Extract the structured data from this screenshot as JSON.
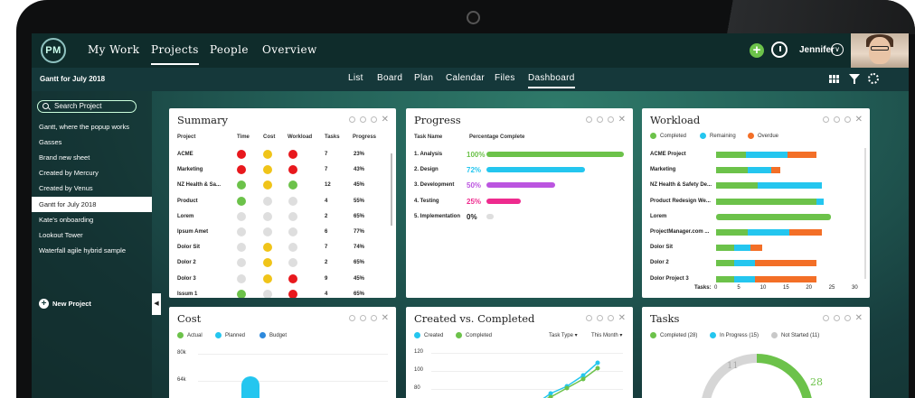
{
  "app": {
    "logo": "PM"
  },
  "topnav": {
    "items": [
      "My Work",
      "Projects",
      "People",
      "Overview"
    ],
    "active": "Projects",
    "user": "Jennifer"
  },
  "subnav": {
    "project": "Gantt for July 2018",
    "tabs": [
      "List",
      "Board",
      "Plan",
      "Calendar",
      "Files",
      "Dashboard"
    ],
    "active": "Dashboard"
  },
  "sidebar": {
    "search_placeholder": "Search Project",
    "items": [
      "Gantt, where the popup works",
      "Gasses",
      "Brand new sheet",
      "Created by Mercury",
      "Created by Venus",
      "Gantt for July 2018",
      "Kate's onboarding",
      "Lookout Tower",
      "Waterfall agile hybrid sample"
    ],
    "active_index": 5,
    "new_project": "New Project"
  },
  "colors": {
    "green": "#6cc24a",
    "yellow": "#f0c419",
    "red": "#e8181d",
    "grey": "#dedede",
    "blue": "#24c6ef",
    "orange": "#f36f27",
    "purple": "#bb55e0",
    "pink": "#ee2b8e",
    "darkblue": "#2d89dc"
  },
  "summary": {
    "title": "Summary",
    "headers": [
      "Project",
      "Time",
      "Cost",
      "Workload",
      "Tasks",
      "Progress"
    ],
    "rows": [
      {
        "project": "ACME",
        "time": "red",
        "cost": "yellow",
        "workload": "red",
        "tasks": "7",
        "progress": "23%"
      },
      {
        "project": "Marketing",
        "time": "red",
        "cost": "yellow",
        "workload": "red",
        "tasks": "7",
        "progress": "43%"
      },
      {
        "project": "NZ Health & Sa...",
        "time": "green",
        "cost": "yellow",
        "workload": "green",
        "tasks": "12",
        "progress": "45%"
      },
      {
        "project": "Product",
        "time": "green",
        "cost": "grey",
        "workload": "grey",
        "tasks": "4",
        "progress": "55%"
      },
      {
        "project": "Lorem",
        "time": "grey",
        "cost": "grey",
        "workload": "grey",
        "tasks": "2",
        "progress": "65%"
      },
      {
        "project": "Ipsum Amet",
        "time": "grey",
        "cost": "grey",
        "workload": "grey",
        "tasks": "6",
        "progress": "77%"
      },
      {
        "project": "Dolor Sit",
        "time": "grey",
        "cost": "yellow",
        "workload": "grey",
        "tasks": "7",
        "progress": "74%"
      },
      {
        "project": "Dolor 2",
        "time": "grey",
        "cost": "yellow",
        "workload": "grey",
        "tasks": "2",
        "progress": "65%"
      },
      {
        "project": "Dolor 3",
        "time": "grey",
        "cost": "yellow",
        "workload": "red",
        "tasks": "9",
        "progress": "45%"
      },
      {
        "project": "Issum 1",
        "time": "green",
        "cost": "grey",
        "workload": "red",
        "tasks": "4",
        "progress": "65%"
      }
    ]
  },
  "progress": {
    "title": "Progress",
    "headers": [
      "Task Name",
      "Percentage Complete"
    ],
    "rows": [
      {
        "name": "1. Analysis",
        "pct": "100%",
        "value": 100,
        "color": "green"
      },
      {
        "name": "2. Design",
        "pct": "72%",
        "value": 72,
        "color": "blue"
      },
      {
        "name": "3. Development",
        "pct": "50%",
        "value": 50,
        "color": "purple"
      },
      {
        "name": "4. Testing",
        "pct": "25%",
        "value": 25,
        "color": "pink"
      },
      {
        "name": "5. Implementation",
        "pct": "0%",
        "value": 0,
        "color": "grey"
      }
    ]
  },
  "workload": {
    "title": "Workload",
    "legend": [
      "Completed",
      "Remaining",
      "Overdue"
    ],
    "axis_label": "Tasks:",
    "ticks": [
      "0",
      "5",
      "10",
      "15",
      "20",
      "25",
      "30"
    ],
    "rows": [
      {
        "name": "ACME Project",
        "completed": 6.5,
        "remaining": 9,
        "overdue": 6.5
      },
      {
        "name": "Marketing",
        "completed": 7,
        "remaining": 5,
        "overdue": 2
      },
      {
        "name": "NZ Health & Safety De...",
        "completed": 9,
        "remaining": 14,
        "overdue": 0
      },
      {
        "name": "Product Redesign We...",
        "completed": 22,
        "remaining": 1.5,
        "overdue": 0
      },
      {
        "name": "Lorem",
        "completed": 25,
        "remaining": 0,
        "overdue": 0
      },
      {
        "name": "ProjectManager.com ...",
        "completed": 7,
        "remaining": 9,
        "overdue": 7
      },
      {
        "name": "Dolor Sit",
        "completed": 4,
        "remaining": 3.5,
        "overdue": 2.5
      },
      {
        "name": "Dolor 2",
        "completed": 4,
        "remaining": 4.5,
        "overdue": 13.5
      },
      {
        "name": "Dolor Project 3",
        "completed": 4,
        "remaining": 4.5,
        "overdue": 13.5
      }
    ]
  },
  "cost": {
    "title": "Cost",
    "legend": [
      "Actual",
      "Planned",
      "Budget"
    ],
    "ticks": [
      "80k",
      "64k"
    ]
  },
  "created": {
    "title": "Created vs. Completed",
    "legend": [
      "Created",
      "Completed"
    ],
    "filters": [
      "Task Type",
      "This Month"
    ],
    "ticks": [
      "120",
      "100",
      "80"
    ]
  },
  "tasks": {
    "title": "Tasks",
    "legend": [
      "Completed (28)",
      "In Progress (15)",
      "Not Started (11)"
    ],
    "labels": [
      "11",
      "28"
    ]
  }
}
